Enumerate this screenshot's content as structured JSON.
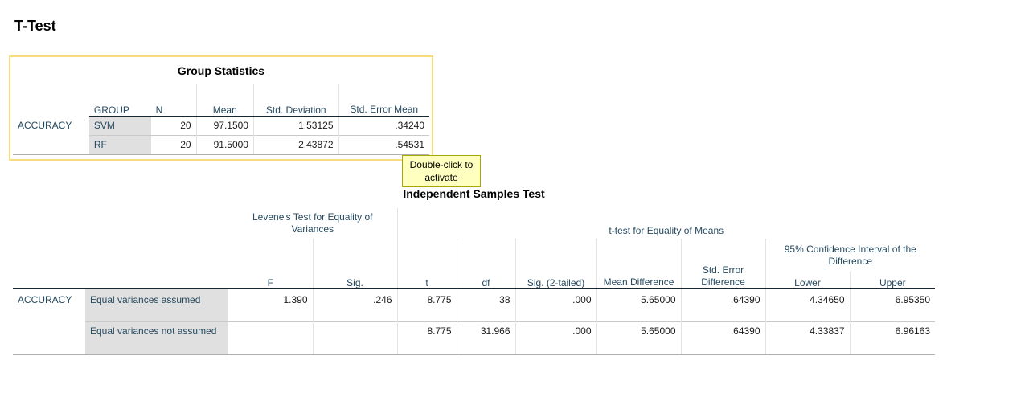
{
  "page_title": "T-Test",
  "tooltip": "Double-click to activate",
  "group_statistics": {
    "title": "Group Statistics",
    "headers": [
      "GROUP",
      "N",
      "Mean",
      "Std. Deviation",
      "Std. Error Mean"
    ],
    "variable": "ACCURACY",
    "rows": [
      {
        "group": "SVM",
        "n": "20",
        "mean": "97.1500",
        "sd": "1.53125",
        "se": ".34240"
      },
      {
        "group": "RF",
        "n": "20",
        "mean": "91.5000",
        "sd": "2.43872",
        "se": ".54531"
      }
    ]
  },
  "independent_test": {
    "title": "Independent Samples Test",
    "levene_header": "Levene's Test for Equality of Variances",
    "ttest_header": "t-test for Equality of Means",
    "ci_header": "95% Confidence Interval of the Difference",
    "columns": {
      "f": "F",
      "sig": "Sig.",
      "t": "t",
      "df": "df",
      "sig2": "Sig. (2-tailed)",
      "mean_diff": "Mean Difference",
      "se_diff": "Std. Error Difference",
      "lower": "Lower",
      "upper": "Upper"
    },
    "variable": "ACCURACY",
    "rows": [
      {
        "label": "Equal variances assumed",
        "f": "1.390",
        "sig": ".246",
        "t": "8.775",
        "df": "38",
        "sig2": ".000",
        "mean_diff": "5.65000",
        "se_diff": ".64390",
        "lower": "4.34650",
        "upper": "6.95350"
      },
      {
        "label": "Equal variances not assumed",
        "f": "",
        "sig": "",
        "t": "8.775",
        "df": "31.966",
        "sig2": ".000",
        "mean_diff": "5.65000",
        "se_diff": ".64390",
        "lower": "4.33837",
        "upper": "6.96163"
      }
    ]
  }
}
